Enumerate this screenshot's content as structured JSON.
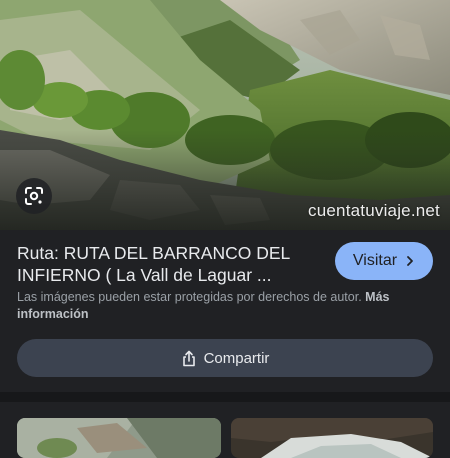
{
  "hero": {
    "watermark": "cuentatuviaje.net",
    "lens_icon": "google-lens-icon"
  },
  "result": {
    "title": "Ruta: RUTA DEL BARRANCO DEL INFIERNO ( La Vall de Laguar ...",
    "visit_label": "Visitar",
    "visit_icon": "chevron-right-icon",
    "copyright_text": "Las imágenes pueden estar protegidas por derechos de autor.",
    "more_info_label": "Más información",
    "share_label": "Compartir",
    "share_icon": "share-icon"
  },
  "colors": {
    "background": "#202124",
    "accent": "#8ab4f8",
    "share_button": "#3c4350"
  }
}
